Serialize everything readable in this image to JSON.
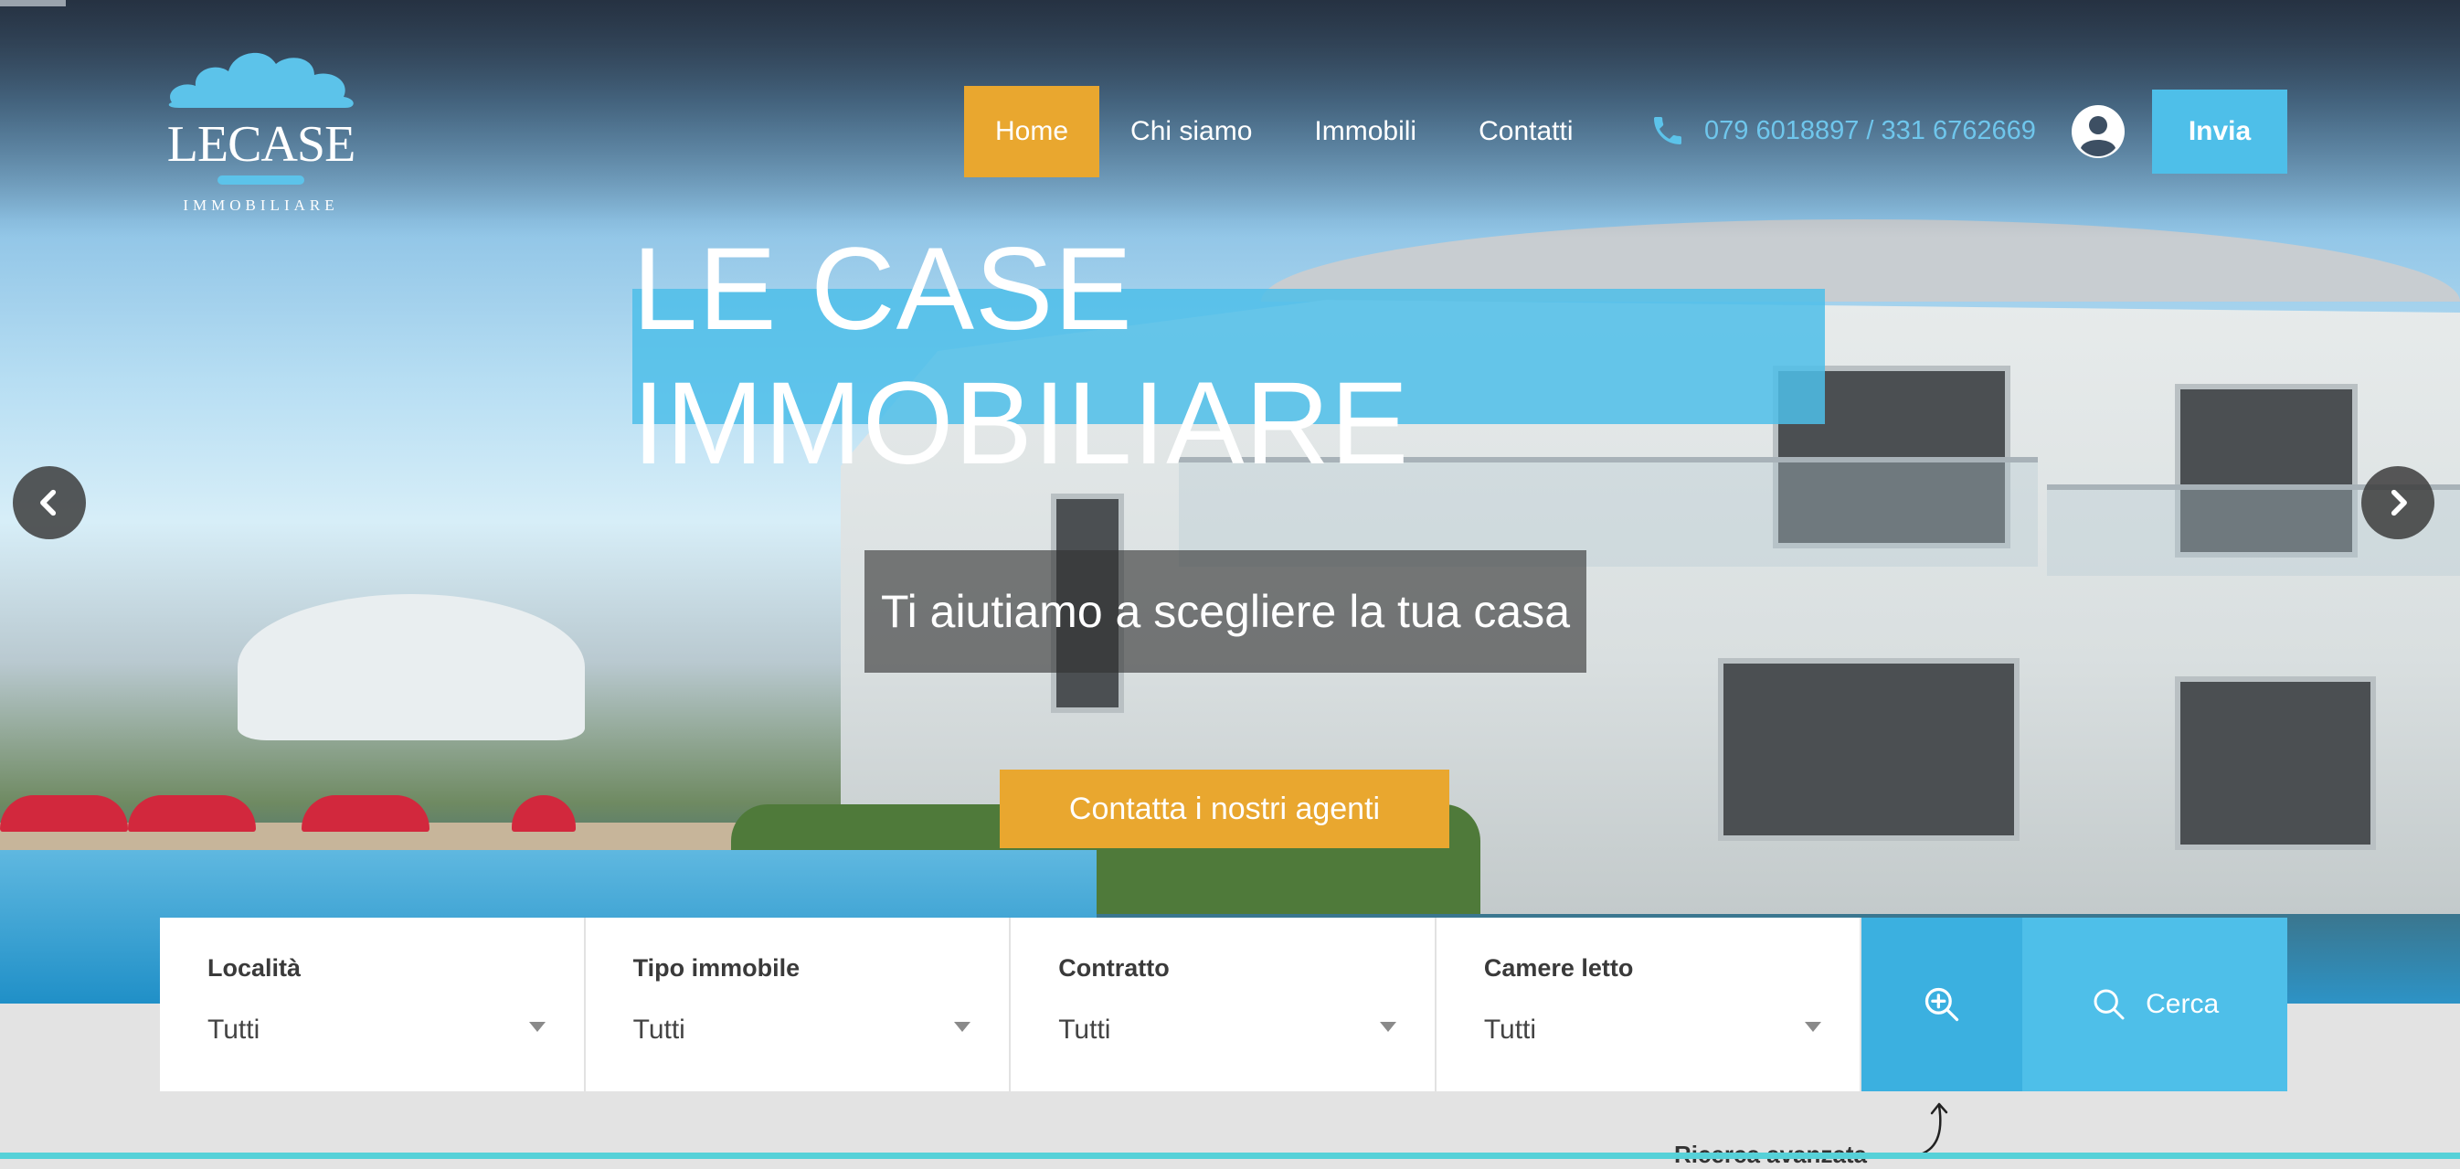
{
  "brand": {
    "name": "LECASE",
    "tagline": "IMMOBILIARE"
  },
  "nav": {
    "items": [
      {
        "label": "Home",
        "active": true
      },
      {
        "label": "Chi siamo",
        "active": false
      },
      {
        "label": "Immobili",
        "active": false
      },
      {
        "label": "Contatti",
        "active": false
      }
    ],
    "phone": "079 6018897 / 331 6762669",
    "phone_icon": "phone-icon",
    "user_icon": "user-circle-icon",
    "send_label": "Invia"
  },
  "hero": {
    "title": "LE CASE IMMOBILIARE",
    "subtitle": "Ti aiutiamo a scegliere la tua casa",
    "cta_label": "Contatta i nostri agenti",
    "prev_icon": "chevron-left-icon",
    "next_icon": "chevron-right-icon"
  },
  "search": {
    "fields": [
      {
        "label": "Località",
        "value": "Tutti"
      },
      {
        "label": "Tipo immobile",
        "value": "Tutti"
      },
      {
        "label": "Contratto",
        "value": "Tutti"
      },
      {
        "label": "Camere letto",
        "value": "Tutti"
      }
    ],
    "advanced_icon": "zoom-in-icon",
    "submit_label": "Cerca",
    "submit_icon": "search-icon",
    "advanced_hint": "Ricerca avanzata"
  },
  "colors": {
    "accent_orange": "#e9a72f",
    "accent_blue": "#4ebfe9",
    "dark_blue": "#3bb0e0",
    "phone_text": "#6fc6ec"
  }
}
